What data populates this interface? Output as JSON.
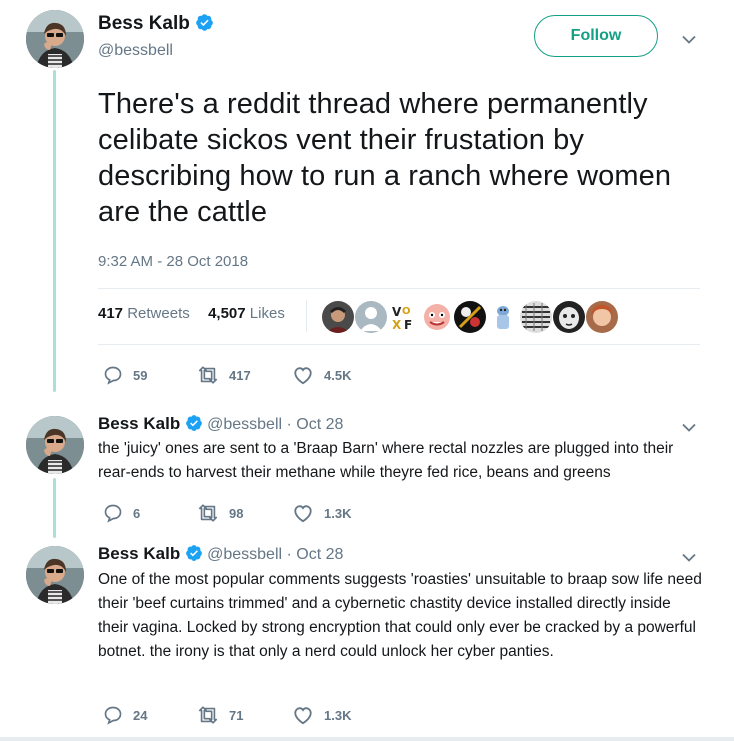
{
  "main_tweet": {
    "author_name": "Bess Kalb",
    "author_handle": "@bessbell",
    "follow_label": "Follow",
    "text": "There's a reddit thread where permanently celibate sickos vent their frustation by describing how to run a ranch where women are the cattle",
    "timestamp": "9:32 AM - 28 Oct 2018",
    "retweets_count": "417",
    "retweets_label": "Retweets",
    "likes_count": "4,507",
    "likes_label": "Likes",
    "actions": {
      "replies": "59",
      "retweets": "417",
      "likes": "4.5K"
    }
  },
  "replies": [
    {
      "author_name": "Bess Kalb",
      "author_handle": "@bessbell",
      "date": "· Oct 28",
      "text": "the 'juicy' ones are sent to a 'Braap Barn' where rectal nozzles are plugged into their rear-ends to harvest their methane while theyre fed rice, beans and greens",
      "actions": {
        "replies": "6",
        "retweets": "98",
        "likes": "1.3K"
      }
    },
    {
      "author_name": "Bess Kalb",
      "author_handle": "@bessbell",
      "date": "· Oct 28",
      "text": "One of the most popular comments suggests 'roasties' unsuitable to braap sow life need their 'beef curtains trimmed' and a cybernetic chastity device installed directly inside their vagina. Locked by strong encryption that could only ever be cracked by a powerful botnet. the irony is that only a nerd could unlock her cyber panties.",
      "actions": {
        "replies": "24",
        "retweets": "71",
        "likes": "1.3K"
      }
    }
  ],
  "colors": {
    "accent": "#14a085",
    "verified": "#1da1f2",
    "thread_line": "#a9e2d4",
    "muted_text": "#657786"
  }
}
